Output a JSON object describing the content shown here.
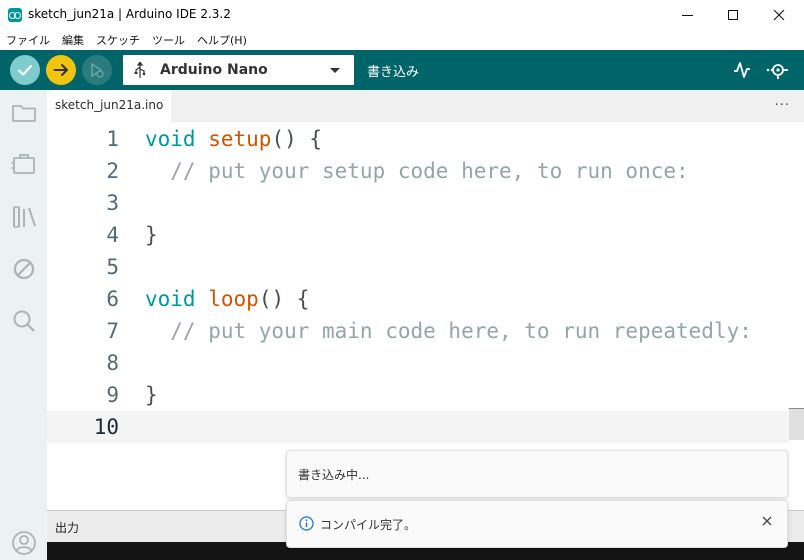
{
  "window": {
    "title": "sketch_jun21a | Arduino IDE 2.3.2"
  },
  "menu": {
    "items": [
      "ファイル",
      "編集",
      "スケッチ",
      "ツール",
      "ヘルプ(H)"
    ]
  },
  "toolbar": {
    "board": "Arduino Nano",
    "status": "書き込み"
  },
  "tabs": [
    {
      "label": "sketch_jun21a.ino"
    }
  ],
  "tab_more": "···",
  "editor": {
    "current_line": 10,
    "lines": [
      {
        "n": "1",
        "text": "void setup() {"
      },
      {
        "n": "2",
        "text": "  // put your setup code here, to run once:"
      },
      {
        "n": "3",
        "text": ""
      },
      {
        "n": "4",
        "text": "}"
      },
      {
        "n": "5",
        "text": ""
      },
      {
        "n": "6",
        "text": "void loop() {"
      },
      {
        "n": "7",
        "text": "  // put your main code here, to run repeatedly:"
      },
      {
        "n": "8",
        "text": ""
      },
      {
        "n": "9",
        "text": "}"
      },
      {
        "n": "10",
        "text": ""
      }
    ]
  },
  "output": {
    "label": "出力"
  },
  "notifications": [
    {
      "text": "書き込み中..."
    },
    {
      "text": "コンパイル完了。"
    }
  ],
  "colors": {
    "toolbar": "#006468",
    "accent": "#00979d",
    "upload": "#f1c40f",
    "function": "#d35400",
    "comment": "#95a5a6"
  },
  "icons": {
    "verify": "check-icon",
    "upload": "arrow-right-icon",
    "debug": "debug-icon",
    "plotter": "serial-plotter-icon",
    "monitor": "serial-monitor-icon",
    "sidebar": [
      "folder-icon",
      "board-manager-icon",
      "library-icon",
      "debug-off-icon",
      "search-icon",
      "account-icon"
    ]
  }
}
